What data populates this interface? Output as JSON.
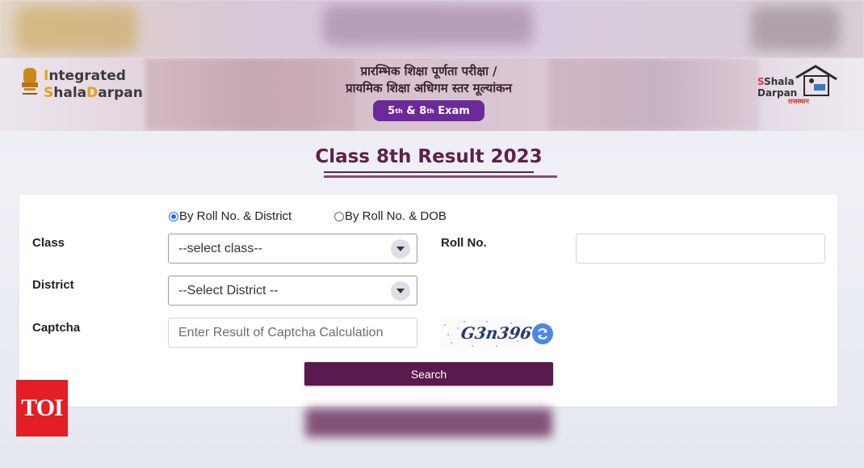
{
  "header": {
    "brand_line1_prefix": "I",
    "brand_line1_rest": "ntegrated",
    "brand_line2_prefix": "S",
    "brand_line2_mid": "hala",
    "brand_line2_prefix2": "D",
    "brand_line2_rest": "arpan",
    "hindi_line1": "प्रारम्भिक शिक्षा पूर्णता परीक्षा /",
    "hindi_line2": "प्रायमिक शिक्षा अधिगम स्तर मूल्यांकन",
    "exam_pill_5": "5",
    "exam_pill_5_sup": "th",
    "exam_pill_amp": "&",
    "exam_pill_8": "8",
    "exam_pill_8_sup": "th",
    "exam_pill_label": "Exam",
    "right_logo_line1": "Shala",
    "right_logo_line2": "Darpan",
    "right_logo_tag": "राजस्थान"
  },
  "page_title": "Class 8th Result 2023",
  "form": {
    "radio_options": [
      {
        "label": "By Roll No. & District",
        "selected": true
      },
      {
        "label": "By Roll No. & DOB",
        "selected": false
      }
    ],
    "class_label": "Class",
    "class_select_value": "--select class--",
    "roll_label": "Roll No.",
    "roll_value": "",
    "district_label": "District",
    "district_select_value": "--Select District --",
    "captcha_label": "Captcha",
    "captcha_placeholder": "Enter Result of Captcha Calculation",
    "captcha_image_text": "G3n396",
    "search_label": "Search"
  },
  "watermark": "TOI",
  "colors": {
    "title": "#5f2049",
    "button": "#5b1a4d",
    "exam_pill": "#6a2a9a",
    "radio_selected": "#2d6cdf",
    "refresh": "#4b86e8",
    "toi": "#e31e24"
  }
}
